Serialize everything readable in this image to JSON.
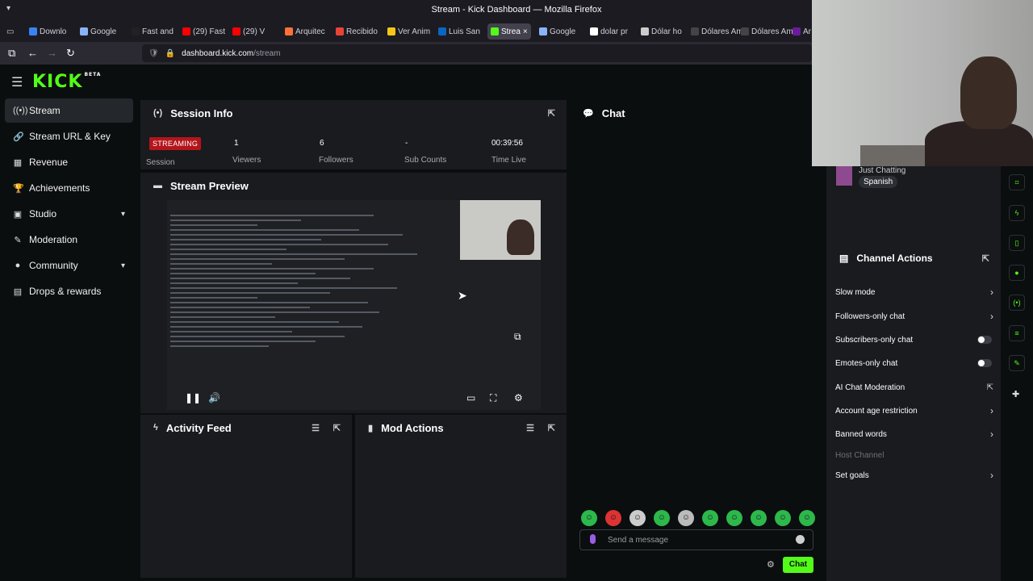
{
  "browser": {
    "window_title": "Stream - Kick Dashboard — Mozilla Firefox",
    "url_domain": "dashboard.kick.com",
    "url_path": "/stream",
    "tabs": [
      {
        "label": "Downlo",
        "color": "#3b82f6"
      },
      {
        "label": "Google",
        "color": "#8ab4f8"
      },
      {
        "label": "Fast and",
        "color": "#222222"
      },
      {
        "label": "(29) Fast",
        "color": "#ff0000"
      },
      {
        "label": "(29) V",
        "color": "#ff0000"
      },
      {
        "label": "Arquitec",
        "color": "#ff7139"
      },
      {
        "label": "Recibido",
        "color": "#ea4335"
      },
      {
        "label": "Ver Anim",
        "color": "#f5c518"
      },
      {
        "label": "Luis San",
        "color": "#0a66c2"
      },
      {
        "label": "Strea",
        "color": "#53fc18"
      },
      {
        "label": "Google",
        "color": "#8ab4f8"
      },
      {
        "label": "dolar pr",
        "color": "#ffffff"
      },
      {
        "label": "Dólar ho",
        "color": "#cccccc"
      },
      {
        "label": "Dólares Am",
        "color": "#444444"
      },
      {
        "label": "Dólares Am",
        "color": "#444444"
      },
      {
        "label": "Ar",
        "color": "#6a1b9a"
      }
    ]
  },
  "sidebar": {
    "items": [
      {
        "label": "Stream",
        "icon": "broadcast-icon",
        "glyph": "((•))"
      },
      {
        "label": "Stream URL & Key",
        "icon": "link-icon",
        "glyph": "🔗"
      },
      {
        "label": "Revenue",
        "icon": "revenue-icon",
        "glyph": "▦"
      },
      {
        "label": "Achievements",
        "icon": "trophy-icon",
        "glyph": "🏆"
      },
      {
        "label": "Studio",
        "icon": "studio-icon",
        "glyph": "▣"
      },
      {
        "label": "Moderation",
        "icon": "wrench-icon",
        "glyph": "✎"
      },
      {
        "label": "Community",
        "icon": "community-icon",
        "glyph": "●"
      },
      {
        "label": "Drops & rewards",
        "icon": "gift-icon",
        "glyph": "▤"
      }
    ]
  },
  "session": {
    "title": "Session Info",
    "status": "STREAMING",
    "session_label": "Session",
    "stats": [
      {
        "value": "1",
        "label": "Viewers"
      },
      {
        "value": "6",
        "label": "Followers"
      },
      {
        "value": "-",
        "label": "Sub Counts"
      },
      {
        "value": "00:39:56",
        "label": "Time Live"
      }
    ]
  },
  "preview": {
    "title": "Stream Preview"
  },
  "activity": {
    "title": "Activity Feed"
  },
  "mod_actions": {
    "title": "Mod Actions"
  },
  "chat": {
    "title": "Chat",
    "placeholder": "Send a message",
    "send_label": "Chat"
  },
  "category": {
    "name": "Just Chatting",
    "language": "Spanish"
  },
  "channel_actions": {
    "title": "Channel Actions",
    "rows": [
      {
        "label": "Slow mode",
        "kind": "arrow"
      },
      {
        "label": "Followers-only chat",
        "kind": "arrow"
      },
      {
        "label": "Subscribers-only chat",
        "kind": "toggle"
      },
      {
        "label": "Emotes-only chat",
        "kind": "toggle"
      },
      {
        "label": "AI Chat Moderation",
        "kind": "external"
      },
      {
        "label": "Account age restriction",
        "kind": "arrow"
      },
      {
        "label": "Banned words",
        "kind": "arrow"
      },
      {
        "label": "Host Channel",
        "kind": "disabled"
      },
      {
        "label": "Set goals",
        "kind": "arrow"
      }
    ]
  },
  "accent_color": "#53fc18",
  "live_color": "#b3151b"
}
